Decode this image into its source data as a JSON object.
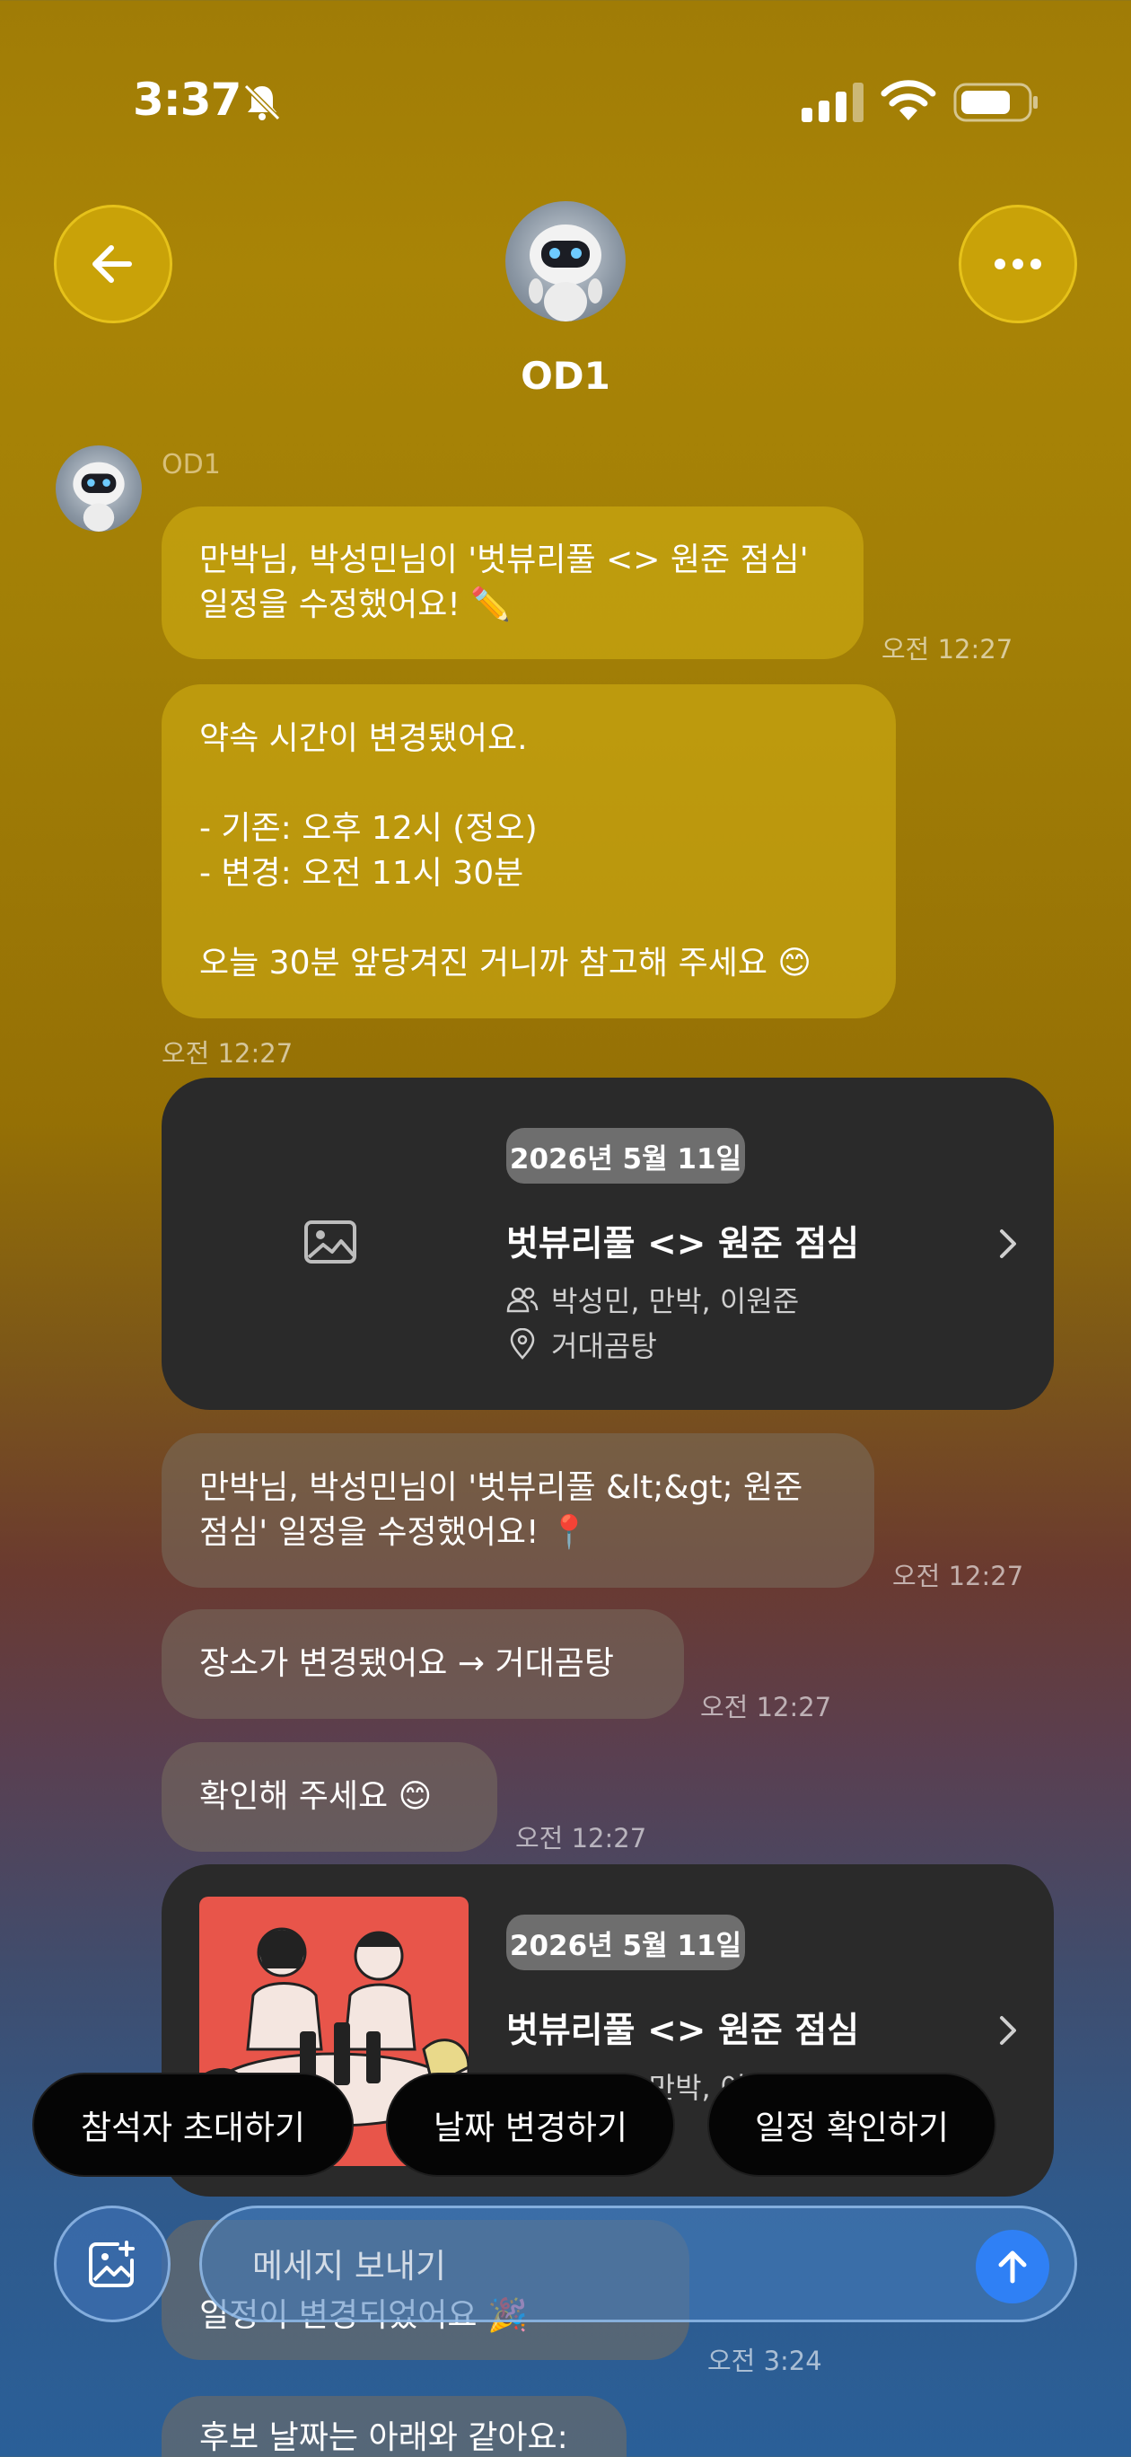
{
  "status": {
    "time": "3:37"
  },
  "header": {
    "title": "OD1"
  },
  "messages": {
    "sender": "OD1",
    "m1": {
      "line1": "만박님, 박성민님이 '벗뷰리풀 <> 원준 점심'",
      "line2": "일정을 수정했어요! ✏️",
      "time": "오전 12:27"
    },
    "m2": {
      "line1": "약속 시간이 변경됐어요.",
      "line2": "- 기존: 오후 12시 (정오)",
      "line3": "- 변경: 오전 11시 30분",
      "line4": "오늘 30분 앞당겨진 거니까 참고해 주세요 😊",
      "time": "오전 12:27"
    },
    "card1": {
      "date": "2026년 5월 11일",
      "title": "벗뷰리풀 <> 원준 점심",
      "participants": "박성민, 만박, 이원준",
      "location": "거대곰탕"
    },
    "m3": {
      "line1": "만박님, 박성민님이 '벗뷰리풀 &lt;&gt; 원준",
      "line2": "점심' 일정을 수정했어요! 📍",
      "time": "오전 12:27"
    },
    "m4": {
      "text": "장소가 변경됐어요 → 거대곰탕",
      "time": "오전 12:27"
    },
    "m5": {
      "text": "확인해 주세요 😊",
      "time": "오전 12:27"
    },
    "card2": {
      "date": "2026년 5월 11일",
      "title": "벗뷰리풀 <> 원준 점심",
      "participants": "박성민, 만박, 이원준"
    },
    "m6": {
      "text": "일정이 변경되었어요 🎉",
      "time": "오전 3:24"
    },
    "m7": {
      "text": "후보 날짜는 아래와 같아요:"
    }
  },
  "quick_actions": [
    "참석자 초대하기",
    "날짜 변경하기",
    "일정 확인하기"
  ],
  "composer": {
    "placeholder": "메세지 보내기"
  }
}
